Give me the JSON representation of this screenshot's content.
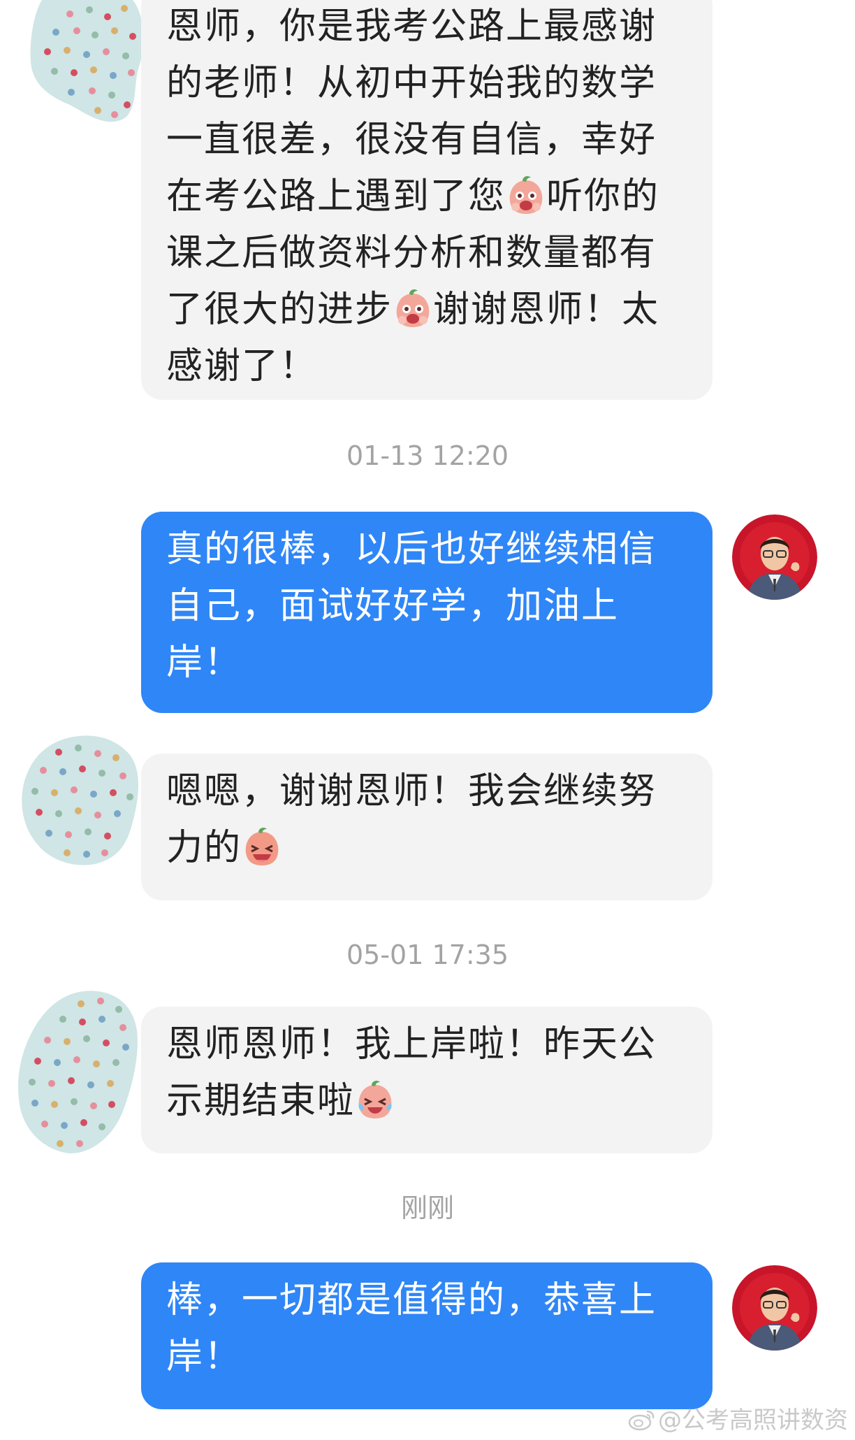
{
  "messages": [
    {
      "lines": [
        {
          "text": "恩师，你是我考公路上最感谢"
        },
        {
          "text": "的老师！从初中开始我的数学"
        },
        {
          "text": "一直很差，很没有自信，幸好"
        },
        {
          "text": "在考公路上遇到了您",
          "emoji": "crying-peach-emoji",
          "after": "听你的"
        },
        {
          "text": "课之后做资料分析和数量都有"
        },
        {
          "text": "了很大的进步",
          "emoji": "crying-peach-emoji",
          "after": "谢谢恩师！太"
        },
        {
          "text": "感谢了！"
        }
      ]
    },
    {
      "timestamp": "01-13 12:20"
    },
    {
      "lines": [
        {
          "text": "真的很棒，以后也好继续相信"
        },
        {
          "text": "自己，面试好好学，加油上"
        },
        {
          "text": "岸！"
        }
      ]
    },
    {
      "lines": [
        {
          "text": "嗯嗯，谢谢恩师！我会继续努"
        },
        {
          "text": "力的",
          "emoji": "laughing-peach-emoji",
          "after": ""
        }
      ]
    },
    {
      "timestamp": "05-01 17:35"
    },
    {
      "lines": [
        {
          "text": "恩师恩师！我上岸啦！昨天公"
        },
        {
          "text": "示期结束啦",
          "emoji": "tears-of-joy-peach-emoji",
          "after": ""
        }
      ]
    },
    {
      "timestamp": "刚刚"
    },
    {
      "lines": [
        {
          "text": "棒，一切都是值得的，恭喜上"
        },
        {
          "text": "岸！"
        }
      ]
    }
  ],
  "watermark": "@公考高照讲数资",
  "colors": {
    "incoming_bubble": "#f3f3f3",
    "outgoing_bubble": "#2f86f7",
    "timestamp_text": "#a3a3a3",
    "avatar_ring": "#c8152a"
  },
  "icons": {
    "incoming_avatar": "polka-dot-blob-avatar",
    "outgoing_avatar": "teacher-photo-avatar",
    "watermark": "weibo-icon"
  }
}
